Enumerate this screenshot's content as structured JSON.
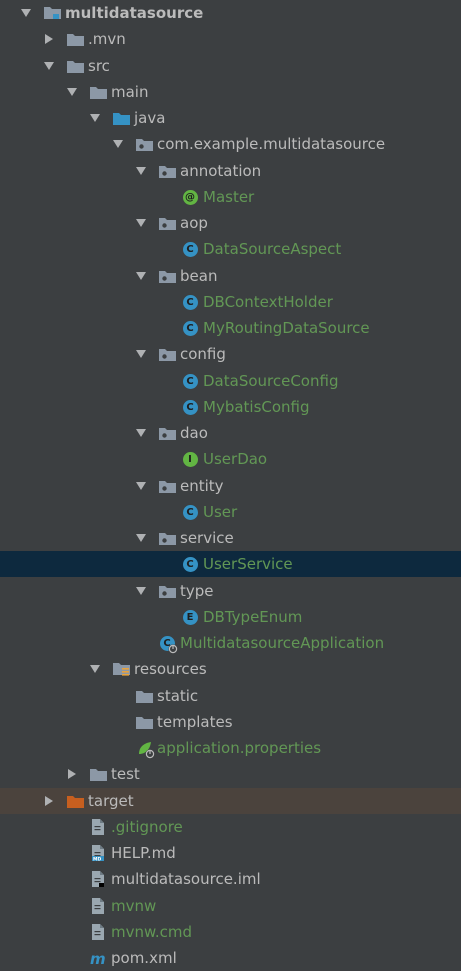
{
  "tree": [
    {
      "label": "multidatasource",
      "depth": 0,
      "arrow": "down",
      "icon": "module-folder-icon",
      "style": "bold"
    },
    {
      "label": ".mvn",
      "depth": 1,
      "arrow": "right",
      "icon": "folder-icon",
      "style": "normal"
    },
    {
      "label": "src",
      "depth": 1,
      "arrow": "down",
      "icon": "folder-icon",
      "style": "normal"
    },
    {
      "label": "main",
      "depth": 2,
      "arrow": "down",
      "icon": "folder-icon",
      "style": "normal"
    },
    {
      "label": "java",
      "depth": 3,
      "arrow": "down",
      "icon": "source-folder-icon",
      "style": "normal"
    },
    {
      "label": "com.example.multidatasource",
      "depth": 4,
      "arrow": "down",
      "icon": "package-icon",
      "style": "normal"
    },
    {
      "label": "annotation",
      "depth": 5,
      "arrow": "down",
      "icon": "package-icon",
      "style": "normal"
    },
    {
      "label": "Master",
      "depth": 6,
      "arrow": "none",
      "icon": "annotation-icon",
      "style": "green"
    },
    {
      "label": "aop",
      "depth": 5,
      "arrow": "down",
      "icon": "package-icon",
      "style": "normal"
    },
    {
      "label": "DataSourceAspect",
      "depth": 6,
      "arrow": "none",
      "icon": "class-icon",
      "style": "green"
    },
    {
      "label": "bean",
      "depth": 5,
      "arrow": "down",
      "icon": "package-icon",
      "style": "normal"
    },
    {
      "label": "DBContextHolder",
      "depth": 6,
      "arrow": "none",
      "icon": "class-icon",
      "style": "green"
    },
    {
      "label": "MyRoutingDataSource",
      "depth": 6,
      "arrow": "none",
      "icon": "class-icon",
      "style": "green"
    },
    {
      "label": "config",
      "depth": 5,
      "arrow": "down",
      "icon": "package-icon",
      "style": "normal"
    },
    {
      "label": "DataSourceConfig",
      "depth": 6,
      "arrow": "none",
      "icon": "class-icon",
      "style": "green"
    },
    {
      "label": "MybatisConfig",
      "depth": 6,
      "arrow": "none",
      "icon": "class-icon",
      "style": "green"
    },
    {
      "label": "dao",
      "depth": 5,
      "arrow": "down",
      "icon": "package-icon",
      "style": "normal"
    },
    {
      "label": "UserDao",
      "depth": 6,
      "arrow": "none",
      "icon": "interface-icon",
      "style": "green"
    },
    {
      "label": "entity",
      "depth": 5,
      "arrow": "down",
      "icon": "package-icon",
      "style": "normal"
    },
    {
      "label": "User",
      "depth": 6,
      "arrow": "none",
      "icon": "class-icon",
      "style": "green"
    },
    {
      "label": "service",
      "depth": 5,
      "arrow": "down",
      "icon": "package-icon",
      "style": "normal"
    },
    {
      "label": "UserService",
      "depth": 6,
      "arrow": "none",
      "icon": "class-icon",
      "style": "green",
      "selected": true
    },
    {
      "label": "type",
      "depth": 5,
      "arrow": "down",
      "icon": "package-icon",
      "style": "normal"
    },
    {
      "label": "DBTypeEnum",
      "depth": 6,
      "arrow": "none",
      "icon": "enum-icon",
      "style": "green"
    },
    {
      "label": "MultidatasourceApplication",
      "depth": 5,
      "arrow": "none",
      "icon": "spring-boot-class-icon",
      "style": "green"
    },
    {
      "label": "resources",
      "depth": 3,
      "arrow": "down",
      "icon": "resources-folder-icon",
      "style": "normal"
    },
    {
      "label": "static",
      "depth": 4,
      "arrow": "none",
      "icon": "folder-icon",
      "style": "normal"
    },
    {
      "label": "templates",
      "depth": 4,
      "arrow": "none",
      "icon": "folder-icon",
      "style": "normal"
    },
    {
      "label": "application.properties",
      "depth": 4,
      "arrow": "none",
      "icon": "spring-properties-icon",
      "style": "green"
    },
    {
      "label": "test",
      "depth": 2,
      "arrow": "right",
      "icon": "folder-icon",
      "style": "normal"
    },
    {
      "label": "target",
      "depth": 1,
      "arrow": "right",
      "icon": "excluded-folder-icon",
      "style": "normal",
      "excluded": true
    },
    {
      "label": ".gitignore",
      "depth": 2,
      "arrow": "none",
      "icon": "text-file-icon",
      "style": "green"
    },
    {
      "label": "HELP.md",
      "depth": 2,
      "arrow": "none",
      "icon": "markdown-file-icon",
      "style": "normal"
    },
    {
      "label": "multidatasource.iml",
      "depth": 2,
      "arrow": "none",
      "icon": "iml-file-icon",
      "style": "normal"
    },
    {
      "label": "mvnw",
      "depth": 2,
      "arrow": "none",
      "icon": "text-file-icon",
      "style": "green"
    },
    {
      "label": "mvnw.cmd",
      "depth": 2,
      "arrow": "none",
      "icon": "text-file-icon",
      "style": "green"
    },
    {
      "label": "pom.xml",
      "depth": 2,
      "arrow": "none",
      "icon": "maven-pom-icon",
      "style": "normal"
    }
  ],
  "colors": {
    "background": "#3c3f41",
    "text": "#bbbbbb",
    "vcs_added": "#629755",
    "selection": "#0d293e",
    "excluded": "#4b433d",
    "folder": "#8c98a6",
    "source_folder": "#3592c4",
    "excluded_folder": "#c75f1f"
  }
}
